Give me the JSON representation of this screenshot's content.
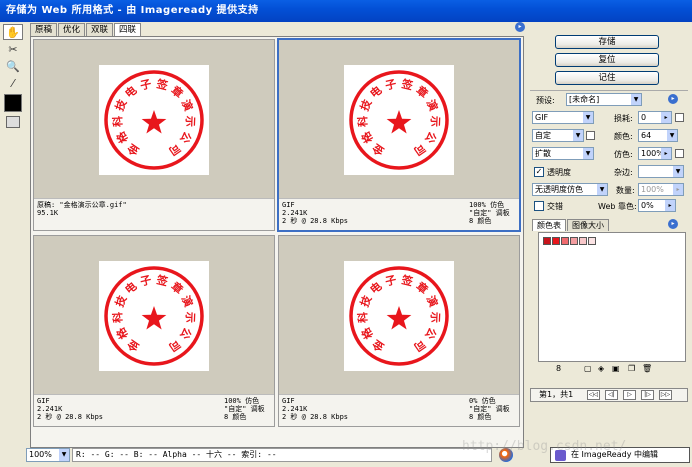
{
  "window": {
    "title": "存储为 Web 所用格式 - 由 Imageready 提供支持"
  },
  "tabs": [
    "原稿",
    "优化",
    "双联",
    "四联"
  ],
  "active_tab": 3,
  "panes": [
    {
      "info_left": [
        "原稿: \"金格演示公章.gif\"",
        "95.1K",
        ""
      ],
      "info_right": [
        "",
        "",
        ""
      ],
      "selected": false
    },
    {
      "info_left": [
        "GIF",
        "2.241K",
        "2 秒 @ 28.8 Kbps"
      ],
      "info_right": [
        "100% 仿色",
        "\"自定\" 调板",
        "8 颜色"
      ],
      "selected": true
    },
    {
      "info_left": [
        "GIF",
        "2.241K",
        "2 秒 @ 28.8 Kbps"
      ],
      "info_right": [
        "100% 仿色",
        "\"自定\" 调板",
        "8 颜色"
      ],
      "selected": false
    },
    {
      "info_left": [
        "GIF",
        "2.241K",
        "2 秒 @ 28.8 Kbps"
      ],
      "info_right": [
        "0% 仿色",
        "\"自定\" 调板",
        "8 颜色"
      ],
      "selected": false
    }
  ],
  "seal": {
    "ring_text": "金格科技电子签章演示公司",
    "color": "#e8161c"
  },
  "right_panel": {
    "buttons": {
      "save": "存储",
      "reset": "复位",
      "remember": "记住"
    },
    "preset_label": "预设:",
    "preset_value": "[未命名]",
    "format_value": "GIF",
    "lossy_label": "损耗:",
    "lossy_value": "0",
    "reduction_value": "自定",
    "colors_label": "颜色:",
    "colors_value": "64",
    "dither_algo": "扩散",
    "dither_label": "仿色:",
    "dither_value": "100%",
    "transparency_label": "透明度",
    "transparency_checked": true,
    "matte_label": "杂边:",
    "matte_value": "",
    "transparency_dither": "无透明度仿色",
    "amount_label": "数量:",
    "amount_value": "100%",
    "interlaced_label": "交错",
    "interlaced_checked": false,
    "web_snap_label": "Web 靠色:",
    "web_snap_value": "0%",
    "color_tab": "颜色表",
    "size_tab": "图像大小",
    "color_count": "8",
    "chips": [
      "#c8141c",
      "#e8161c",
      "#f06a6e",
      "#f39da0",
      "#f8c7c9",
      "#fbe3e4"
    ],
    "nav_text": "第1，共1"
  },
  "status": {
    "zoom": "100%",
    "pixel_info": "R: -- G: -- B: -- Alpha -- 十六 -- 索引: --",
    "edit_button": "在 ImageReady 中编辑"
  },
  "watermark": "http://blog.csdn.net/"
}
